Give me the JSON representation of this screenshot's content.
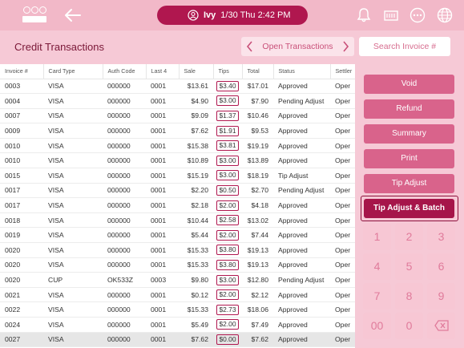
{
  "topbar": {
    "user_name": "Ivy",
    "datetime": "1/30 Thu 2:42 PM",
    "icons": [
      "bell-icon",
      "cash-register-icon",
      "more-icon",
      "globe-icon"
    ]
  },
  "page": {
    "title": "Credit Transactions",
    "open_transactions_label": "Open Transactions",
    "search_placeholder": "Search Invoice #"
  },
  "table": {
    "headers": [
      "Invoice #",
      "Card Type",
      "Auth Code",
      "Last 4",
      "Sale",
      "Tips",
      "Total",
      "Status",
      "Settler"
    ],
    "rows": [
      [
        "0003",
        "VISA",
        "000000",
        "0001",
        "$13.61",
        "$3.40",
        "$17.01",
        "Approved",
        "Oper"
      ],
      [
        "0004",
        "VISA",
        "000000",
        "0001",
        "$4.90",
        "$3.00",
        "$7.90",
        "Pending Adjust",
        "Oper"
      ],
      [
        "0007",
        "VISA",
        "000000",
        "0001",
        "$9.09",
        "$1.37",
        "$10.46",
        "Approved",
        "Oper"
      ],
      [
        "0009",
        "VISA",
        "000000",
        "0001",
        "$7.62",
        "$1.91",
        "$9.53",
        "Approved",
        "Oper"
      ],
      [
        "0010",
        "VISA",
        "000000",
        "0001",
        "$15.38",
        "$3.81",
        "$19.19",
        "Approved",
        "Oper"
      ],
      [
        "0010",
        "VISA",
        "000000",
        "0001",
        "$10.89",
        "$3.00",
        "$13.89",
        "Approved",
        "Oper"
      ],
      [
        "0015",
        "VISA",
        "000000",
        "0001",
        "$15.19",
        "$3.00",
        "$18.19",
        "Tip Adjust",
        "Oper"
      ],
      [
        "0017",
        "VISA",
        "000000",
        "0001",
        "$2.20",
        "$0.50",
        "$2.70",
        "Pending Adjust",
        "Oper"
      ],
      [
        "0017",
        "VISA",
        "000000",
        "0001",
        "$2.18",
        "$2.00",
        "$4.18",
        "Approved",
        "Oper"
      ],
      [
        "0018",
        "VISA",
        "000000",
        "0001",
        "$10.44",
        "$2.58",
        "$13.02",
        "Approved",
        "Oper"
      ],
      [
        "0019",
        "VISA",
        "000000",
        "0001",
        "$5.44",
        "$2.00",
        "$7.44",
        "Approved",
        "Oper"
      ],
      [
        "0020",
        "VISA",
        "000000",
        "0001",
        "$15.33",
        "$3.80",
        "$19.13",
        "Approved",
        "Oper"
      ],
      [
        "0020",
        "VISA",
        "000000",
        "0001",
        "$15.33",
        "$3.80",
        "$19.13",
        "Approved",
        "Oper"
      ],
      [
        "0020",
        "CUP",
        "OK533Z",
        "0003",
        "$9.80",
        "$3.00",
        "$12.80",
        "Pending Adjust",
        "Oper"
      ],
      [
        "0021",
        "VISA",
        "000000",
        "0001",
        "$0.12",
        "$2.00",
        "$2.12",
        "Approved",
        "Oper"
      ],
      [
        "0022",
        "VISA",
        "000000",
        "0001",
        "$15.33",
        "$2.73",
        "$18.06",
        "Approved",
        "Oper"
      ],
      [
        "0024",
        "VISA",
        "000000",
        "0001",
        "$5.49",
        "$2.00",
        "$7.49",
        "Approved",
        "Oper"
      ],
      [
        "0027",
        "VISA",
        "000000",
        "0001",
        "$7.62",
        "$0.00",
        "$7.62",
        "Approved",
        "Oper"
      ]
    ],
    "highlighted_row": 17
  },
  "actions": {
    "void": "Void",
    "refund": "Refund",
    "summary": "Summary",
    "print": "Print",
    "tip_adjust": "Tip Adjust",
    "tip_adjust_batch": "Tip Adjust & Batch"
  },
  "keypad": {
    "keys": [
      "1",
      "2",
      "3",
      "4",
      "5",
      "6",
      "7",
      "8",
      "9",
      "00",
      "0",
      "backspace"
    ]
  },
  "colors": {
    "accent": "#b0174f",
    "button": "#d9638b",
    "background": "#f6c9d6"
  }
}
